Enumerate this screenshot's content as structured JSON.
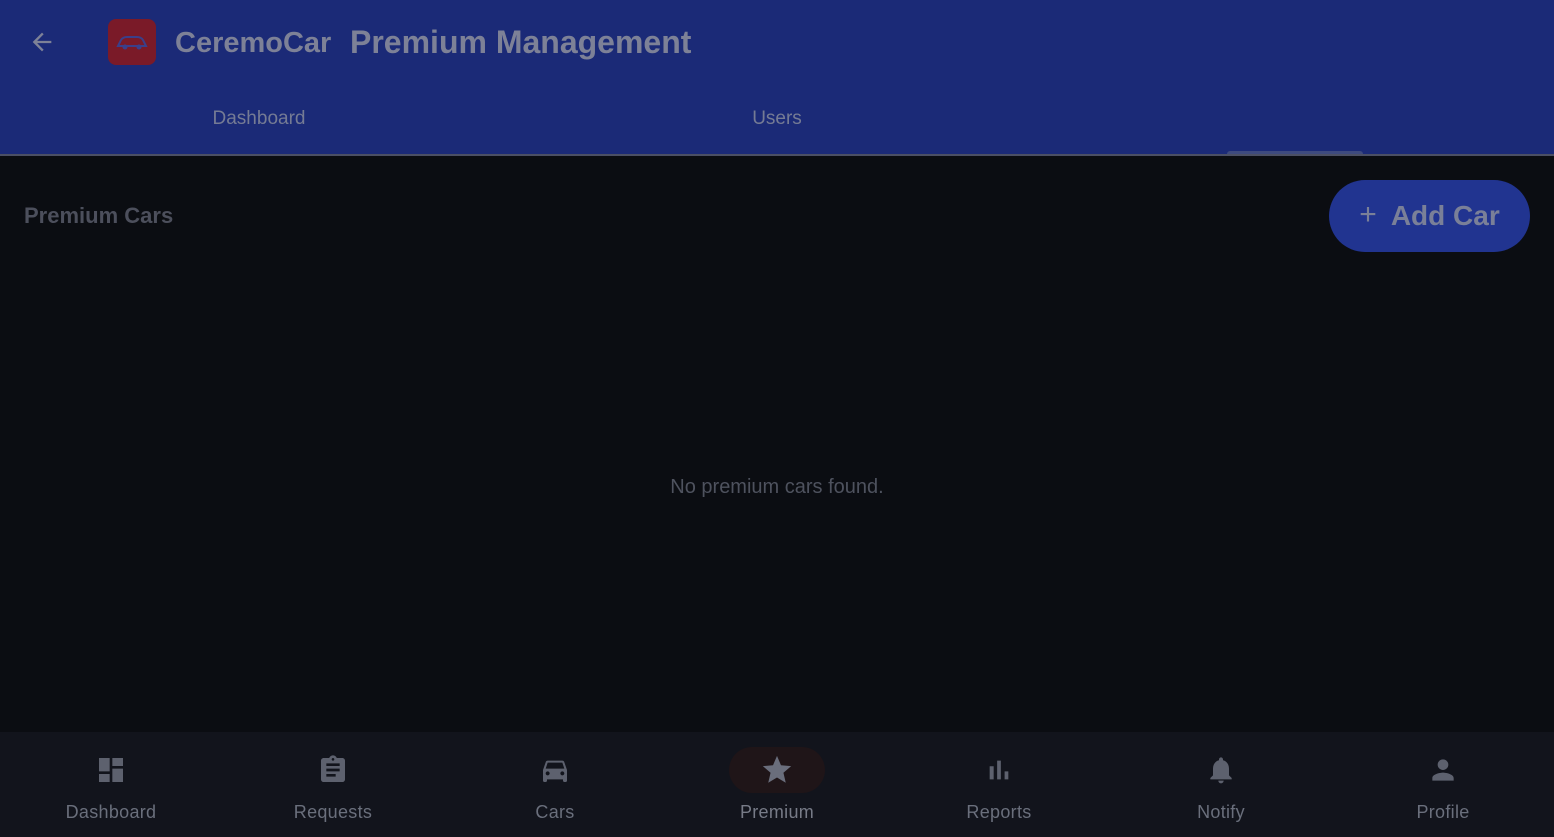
{
  "header": {
    "brand": "CeremoCar",
    "title": "Premium Management",
    "back_icon": "arrow-back-icon",
    "logo_icon": "car-logo-icon",
    "color": "#1b2a77"
  },
  "tabs": [
    {
      "label": "Dashboard"
    },
    {
      "label": "Users"
    },
    {
      "label": ""
    }
  ],
  "main": {
    "section_title": "Premium Cars",
    "add_button": {
      "label": "Add Car",
      "icon": "plus-icon"
    },
    "empty_message": "No premium cars found."
  },
  "bottom_nav": {
    "items": [
      {
        "label": "Dashboard",
        "icon": "dashboard-icon"
      },
      {
        "label": "Requests",
        "icon": "clipboard-icon"
      },
      {
        "label": "Cars",
        "icon": "car-icon"
      },
      {
        "label": "Premium",
        "icon": "star-icon",
        "active": true
      },
      {
        "label": "Reports",
        "icon": "bar-chart-icon"
      },
      {
        "label": "Notify",
        "icon": "bell-icon"
      },
      {
        "label": "Profile",
        "icon": "person-icon"
      }
    ]
  }
}
